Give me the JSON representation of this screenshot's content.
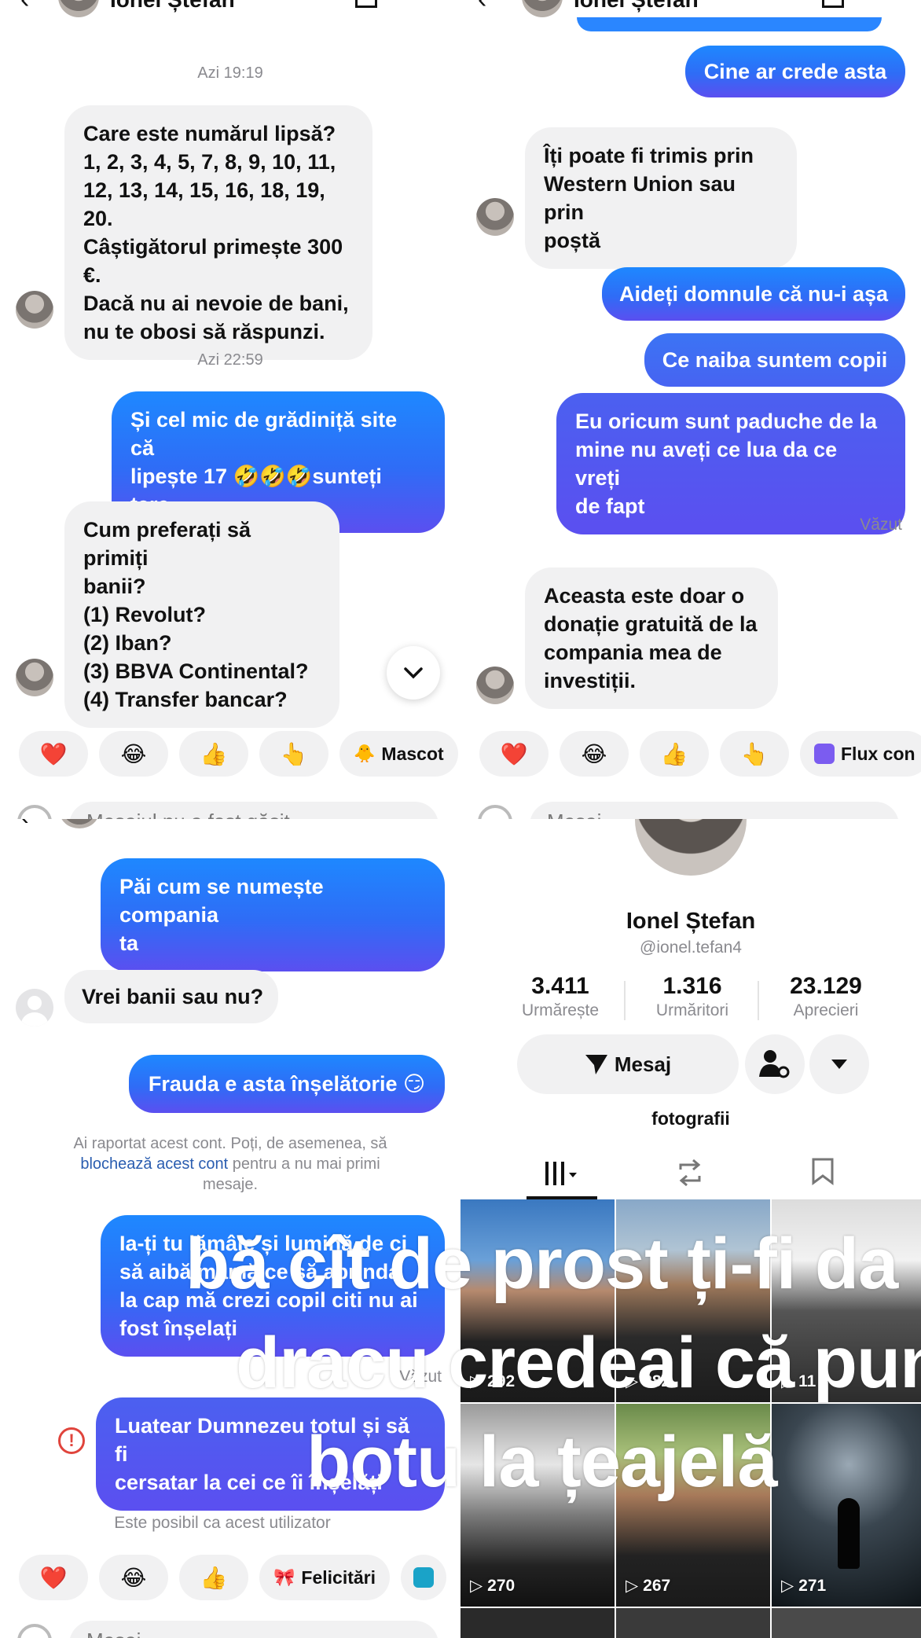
{
  "chat": {
    "contact_name": "Ionel Ștefan",
    "p1": {
      "time1": "Azi 19:19",
      "msg_quiz": "Care este numărul lipsă?\n1, 2, 3, 4, 5, 7, 8, 9, 10, 11,\n12, 13, 14, 15, 16, 18, 19, 20.\nCâștigătorul primește 300\n€.\nDacă nu ai nevoie de bani,\nnu te obosi să răspunzi.",
      "time2": "Azi 22:59",
      "msg_reply1": "Și cel mic de grădiniță site că\nlipește 17 🤣🤣🤣sunteți tare",
      "msg_payment": "Cum preferați să primiți\nbanii?\n(1) Revolut?\n(2) Iban?\n(3) BBVA Continental?\n(4) Transfer bancar?",
      "input_placeholder": "Mesajul nu a fost găsit"
    },
    "p2": {
      "msg_cine": "Cine ar crede asta",
      "msg_western": "Îți poate fi trimis prin\nWestern Union sau prin\npoștă",
      "msg_aideti": "Aideți domnule că nu-i așa",
      "msg_ce_naiba": "Ce naiba suntem copii",
      "msg_eu": "Eu oricum sunt paduche de la\nmine nu aveți ce lua da ce vreți\nde fapt",
      "seen": "Văzut",
      "msg_donatie": "Aceasta este doar o\ndonație gratuită de la\ncompania mea de\ninvestiții.",
      "input_placeholder": "Mesaj"
    },
    "p3": {
      "msg_compania": "Păi cum se numește compania\nta",
      "msg_vrei": "Vrei banii sau nu?",
      "msg_frauda": "Frauda e asta înșelătorie 😏",
      "report_line1": "Ai raportat acest cont. Poți, de asemenea, să",
      "report_link": "blochează acest cont",
      "report_line2": " pentru a nu mai primi",
      "report_line3": "mesaje.",
      "msg_iati": "Ia-ți tu lămâie și lumină de ci\nsă aibă mamă ce să aprinda\nla cap mă crezi copil citi nu ai\nfost înșelați",
      "seen": "Văzut",
      "msg_luatear": "Luatear Dumnezeu totul și să fi\ncersatar la cei ce îi înșelăți",
      "warning": "Este posibil ca acest utilizator",
      "input_placeholder": "Mesaj"
    },
    "reactions": {
      "heart": "❤️",
      "laugh": "😂",
      "thumbs": "👍",
      "point": "👆",
      "mascot": "Mascot",
      "flux": "Flux con",
      "felicitari": "Felicitări"
    }
  },
  "profile": {
    "name": "Ionel Ștefan",
    "handle": "@ionel.tefan4",
    "stats": [
      {
        "value": "3.411",
        "label": "Urmărește"
      },
      {
        "value": "1.316",
        "label": "Urmăritori"
      },
      {
        "value": "23.129",
        "label": "Aprecieri"
      }
    ],
    "message_button": "Mesaj",
    "bio": "fotografii",
    "thumbs": [
      "292",
      "282",
      "11",
      "270",
      "267",
      "271"
    ]
  },
  "caption": {
    "line1": "bă cît de prost ți-fi da",
    "line2": "dracu credeai că pun",
    "line3": "botu la țeajelă"
  },
  "colors": {
    "out_bubble_top": "#1e88ff",
    "out_bubble_bottom": "#5b4ff0",
    "in_bubble": "#f1f1f2",
    "link": "#2a5db0",
    "warning_red": "#e0443c"
  }
}
